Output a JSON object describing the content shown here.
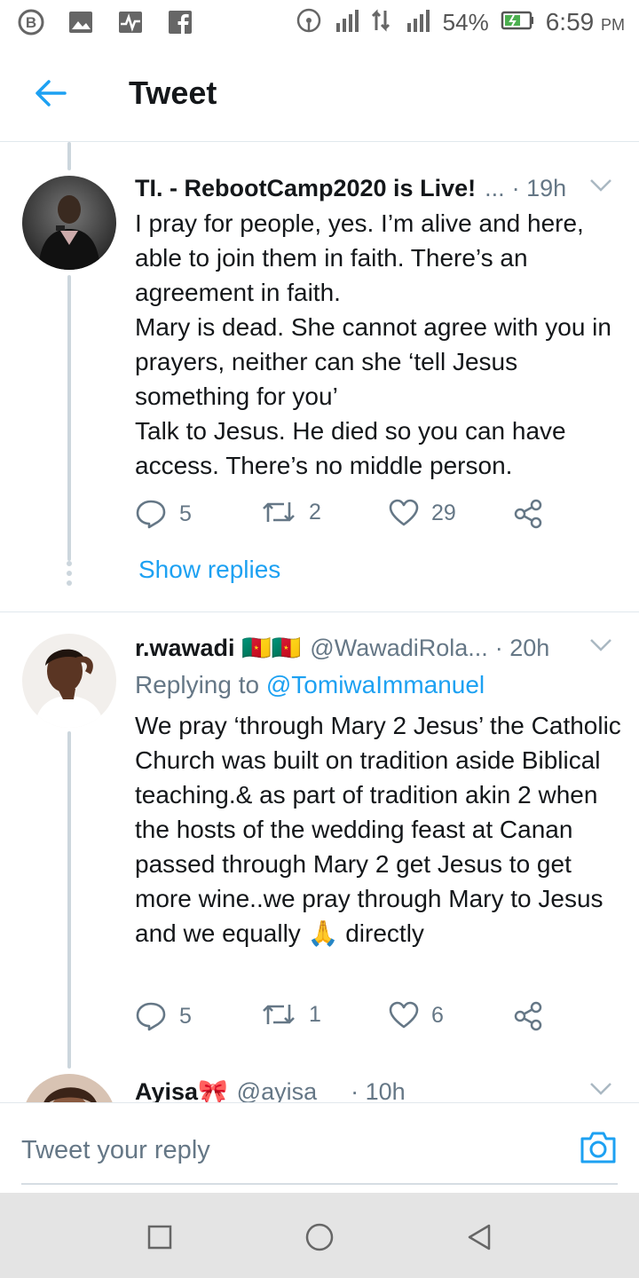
{
  "status_bar": {
    "battery_percent": "54%",
    "time": "6:59",
    "ampm": "PM",
    "icons": [
      "b-app-icon",
      "image-icon",
      "pulse-icon",
      "facebook-icon",
      "hotspot-icon",
      "signal-icon",
      "data-arrows-icon",
      "signal-icon",
      "battery-icon"
    ]
  },
  "header": {
    "title": "Tweet"
  },
  "tweets": [
    {
      "name": "TI. - RebootCamp2020 is Live!",
      "ellipsis": "...",
      "time": "· 19h",
      "body": "I pray for people, yes. I’m alive and here, able to join them in faith. There’s an agreement in faith.\nMary is dead. She cannot agree with you in prayers, neither can she ‘tell Jesus something for you’\nTalk to Jesus. He died so you can have access. There’s no middle person.",
      "replies": "5",
      "retweets": "2",
      "likes": "29",
      "show_replies": "Show replies"
    },
    {
      "name": "r.wawadi 🇨🇲🇨🇲",
      "handle": "@WawadiRola...",
      "time": "· 20h",
      "replying_prefix": "Replying to",
      "replying_handle": "@TomiwaImmanuel",
      "body": "We pray ‘through Mary 2 Jesus’ the Catholic Church was built on tradition aside Biblical teaching.& as part of tradition akin 2 when the hosts of the wedding feast at Canan passed through Mary 2 get Jesus to get more wine..we pray through Mary to Jesus and we equally 🙏 directly",
      "replies": "5",
      "retweets": "1",
      "likes": "6"
    },
    {
      "name": "Ayisa🎀",
      "handle": "@ayisa__",
      "time": "· 10h"
    }
  ],
  "reply_bar": {
    "placeholder": "Tweet your reply"
  },
  "colors": {
    "accent": "#1da1f2",
    "secondary_text": "#657786",
    "divider": "#e1e8ed"
  }
}
